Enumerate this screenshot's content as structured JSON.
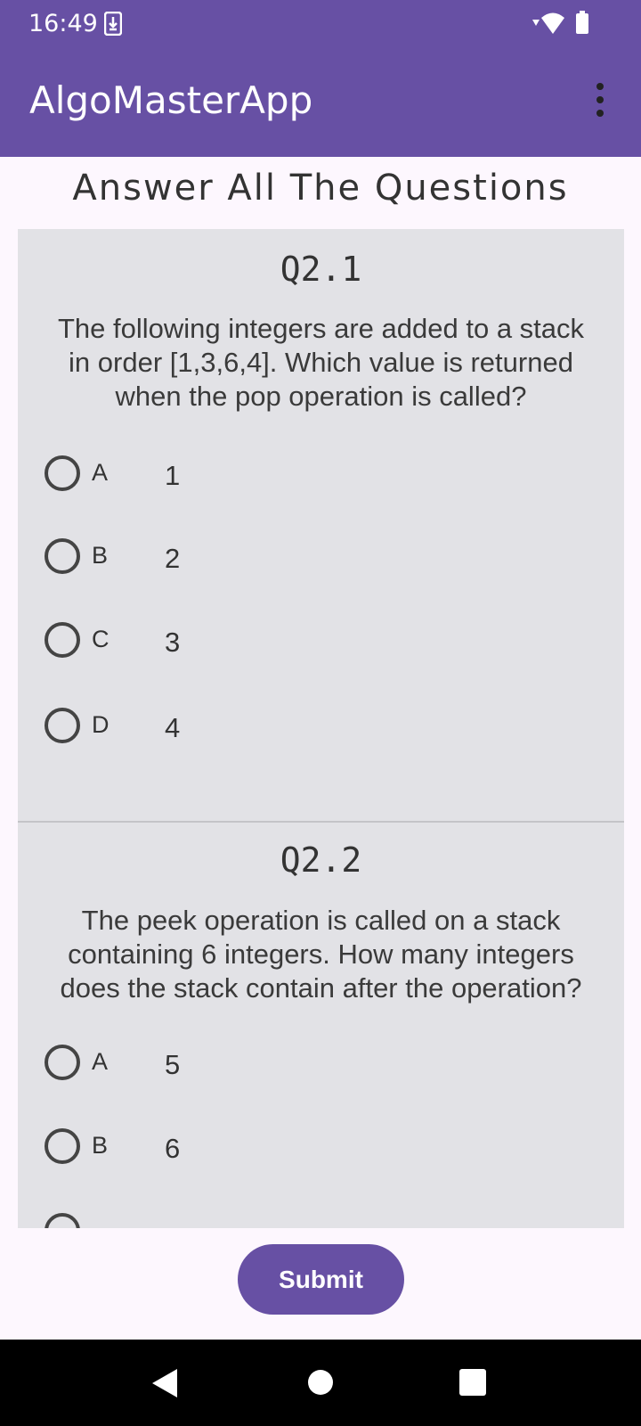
{
  "status_bar": {
    "time": "16:49"
  },
  "app_bar": {
    "title": "AlgoMasterApp"
  },
  "page": {
    "heading": "Answer All The Questions"
  },
  "questions": [
    {
      "number": "Q2.1",
      "text": "The following integers are added to a stack in order [1,3,6,4]. Which value is returned when the pop operation is called?",
      "options": [
        {
          "letter": "A",
          "value": "1"
        },
        {
          "letter": "B",
          "value": "2"
        },
        {
          "letter": "C",
          "value": "3"
        },
        {
          "letter": "D",
          "value": "4"
        }
      ]
    },
    {
      "number": "Q2.2",
      "text": "The peek operation is called on a stack containing 6 integers. How many integers does the stack contain after the operation?",
      "options": [
        {
          "letter": "A",
          "value": "5"
        },
        {
          "letter": "B",
          "value": "6"
        }
      ]
    }
  ],
  "submit": {
    "label": "Submit"
  },
  "colors": {
    "primary": "#6750a4",
    "panel": "#e2e2e6",
    "background": "#fdf7fe"
  }
}
